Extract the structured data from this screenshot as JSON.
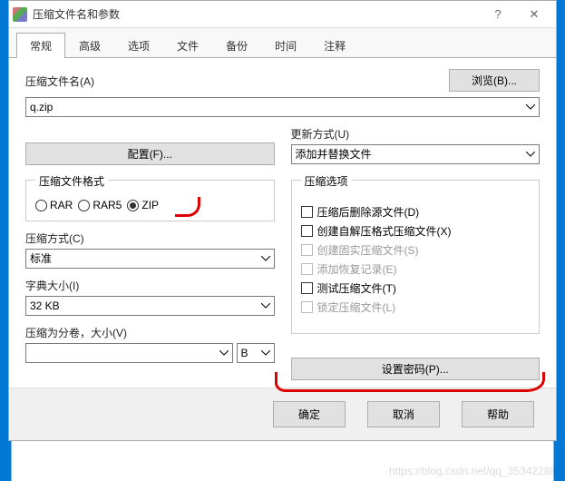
{
  "titlebar": {
    "title": "压缩文件名和参数"
  },
  "tabs": [
    "常规",
    "高级",
    "选项",
    "文件",
    "备份",
    "时间",
    "注释"
  ],
  "filename": {
    "label": "压缩文件名(A)",
    "browse_label": "浏览(B)...",
    "value": "q.zip"
  },
  "profile": {
    "button_label": "配置(F)..."
  },
  "update": {
    "label": "更新方式(U)",
    "value": "添加并替换文件"
  },
  "format": {
    "legend": "压缩文件格式",
    "options": [
      "RAR",
      "RAR5",
      "ZIP"
    ],
    "selected": "ZIP"
  },
  "method": {
    "label": "压缩方式(C)",
    "value": "标准"
  },
  "dict": {
    "label": "字典大小(I)",
    "value": "32 KB"
  },
  "split": {
    "label": "压缩为分卷，大小(V)",
    "size_value": "",
    "unit_value": "B"
  },
  "options": {
    "legend": "压缩选项",
    "items": [
      {
        "label": "压缩后删除源文件(D)",
        "enabled": true,
        "checked": false
      },
      {
        "label": "创建自解压格式压缩文件(X)",
        "enabled": true,
        "checked": false
      },
      {
        "label": "创建固实压缩文件(S)",
        "enabled": false,
        "checked": false
      },
      {
        "label": "添加恢复记录(E)",
        "enabled": false,
        "checked": false
      },
      {
        "label": "测试压缩文件(T)",
        "enabled": true,
        "checked": false
      },
      {
        "label": "锁定压缩文件(L)",
        "enabled": false,
        "checked": false
      }
    ]
  },
  "password": {
    "button_label": "设置密码(P)..."
  },
  "footer": {
    "ok": "确定",
    "cancel": "取消",
    "help": "帮助"
  },
  "watermark": "https://blog.csdn.net/qq_35342288"
}
